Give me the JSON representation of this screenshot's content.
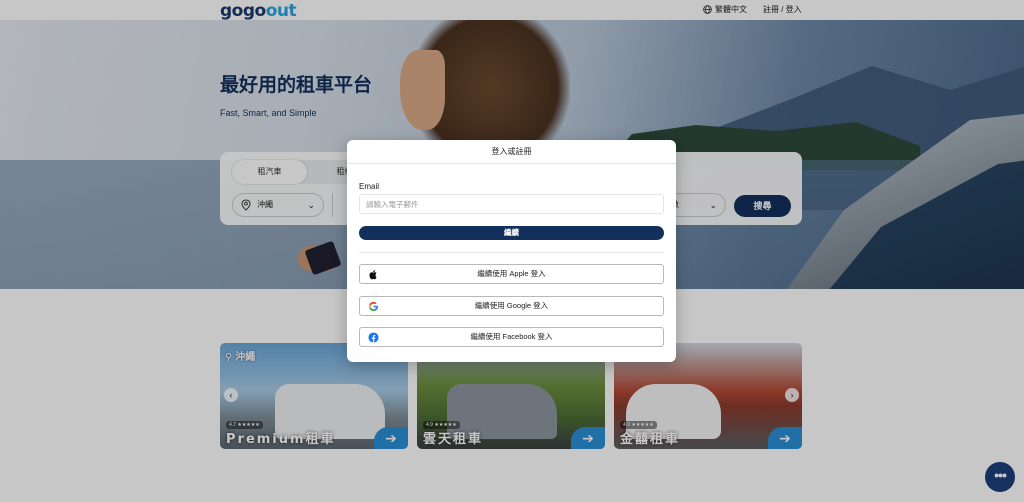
{
  "header": {
    "logo_part1": "gogo",
    "logo_part2": "out",
    "language": "繁體中文",
    "login": "註冊 / 登入"
  },
  "hero": {
    "title": "最好用的租車平台",
    "subtitle": "Fast, Smart, and Simple"
  },
  "search": {
    "tabs": [
      "租汽車",
      "租機"
    ],
    "location": "沖繩",
    "right_field": "數",
    "search_button": "搜尋"
  },
  "modal": {
    "title": "登入或註冊",
    "email_label": "Email",
    "email_placeholder": "請輸入電子郵件",
    "continue_label": "繼續",
    "apple_label": "繼續使用 Apple 登入",
    "google_label": "繼續使用 Google 登入",
    "facebook_label": "繼續使用 Facebook 登入"
  },
  "cards": [
    {
      "location": "沖繩",
      "rating": "4.7 ★★★★★",
      "name": "Premium租車"
    },
    {
      "location": "",
      "rating": "4.9 ★★★★★",
      "name": "雲天租車"
    },
    {
      "location": "",
      "rating": "4.9 ★★★★★",
      "name": "金囍租車"
    }
  ],
  "colors": {
    "brand_navy": "#13305c",
    "brand_blue": "#2b8fd6"
  }
}
